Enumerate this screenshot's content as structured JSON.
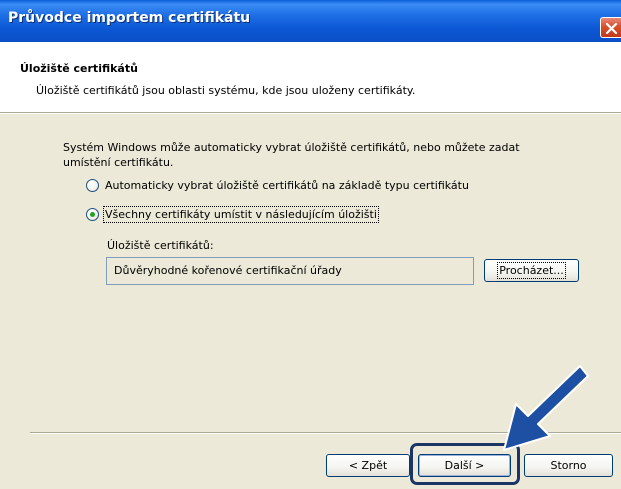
{
  "window": {
    "title": "Průvodce importem certifikátu"
  },
  "header": {
    "title": "Úložiště certifikátů",
    "subtitle": "Úložiště certifikátů jsou oblasti systému, kde jsou uloženy certifikáty."
  },
  "body": {
    "intro": "Systém Windows může automaticky vybrat úložiště certifikátů, nebo můžete zadat umístění certifikátu.",
    "options": [
      {
        "label": "Automaticky vybrat úložiště certifikátů na základě typu certifikátu",
        "selected": false
      },
      {
        "label": "Všechny certifikáty umístit v následujícím úložišti",
        "selected": true
      }
    ],
    "store_label": "Úložiště certifikátů:",
    "store_value": "Důvěryhodné kořenové certifikační úřady",
    "browse_button": "Procházet..."
  },
  "footer": {
    "back_button": "< Zpět",
    "next_button": "Další >",
    "cancel_button": "Storno"
  },
  "colors": {
    "titlebar": "#0c57d4",
    "dialog_bg": "#ece9d8",
    "radio_dot": "#21a121",
    "annotation_arrow": "#1d4fa2",
    "annotation_box": "#1b3566"
  }
}
